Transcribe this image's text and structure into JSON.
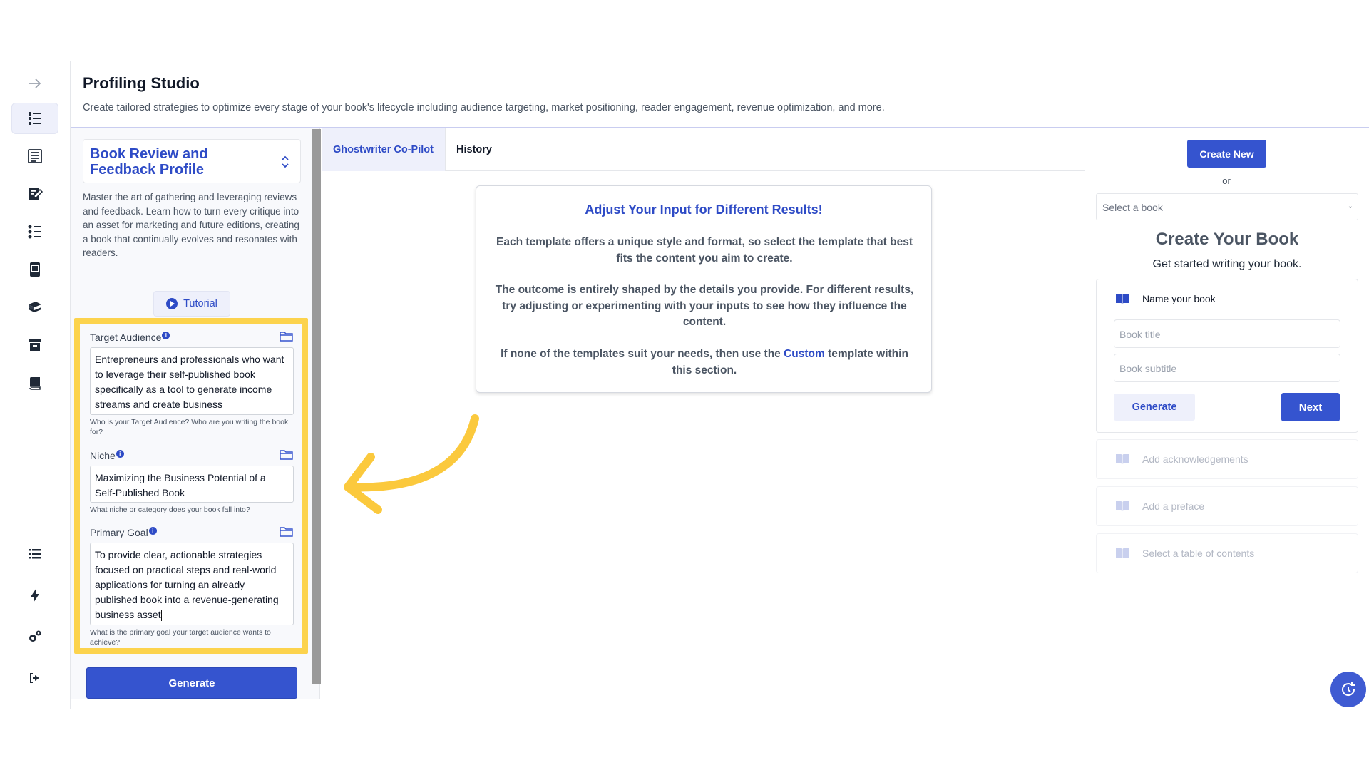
{
  "header": {
    "title": "Profiling Studio",
    "subtitle": "Create tailored strategies to optimize every stage of your book's lifecycle including audience targeting, market positioning, reader engagement, revenue optimization, and more."
  },
  "rail": {
    "icons": [
      "arrow-right-icon",
      "numbered-list-icon",
      "document-list-icon",
      "note-pen-icon",
      "checklist-icon",
      "mobile-book-icon",
      "books-stack-icon",
      "archive-icon",
      "book-icon",
      "list-icon",
      "lightning-icon",
      "gears-icon",
      "logout-icon"
    ]
  },
  "profile": {
    "title": "Book Review and Feedback Profile",
    "description": "Master the art of gathering and leveraging reviews and feedback. Learn how to turn every critique into an asset for marketing and future editions, creating a book that continually evolves and resonates with readers.",
    "tutorial_label": "Tutorial"
  },
  "fields": {
    "target_audience": {
      "label": "Target Audience",
      "value": "Entrepreneurs and professionals who want to leverage their self-published book specifically as a tool to generate income streams and create business",
      "hint": "Who is your Target Audience? Who are you writing the book for?"
    },
    "niche": {
      "label": "Niche",
      "value": "Maximizing the Business Potential of a Self-Published Book",
      "hint": "What niche or category does your book fall into?"
    },
    "primary_goal": {
      "label": "Primary Goal",
      "value": "To provide clear, actionable strategies focused on practical steps and real-world applications for turning an already published book into a revenue-generating business asset",
      "hint": "What is the primary goal your target audience wants to achieve?"
    }
  },
  "generate_label": "Generate",
  "tabs": [
    {
      "label": "Ghostwriter Co-Pilot",
      "active": true
    },
    {
      "label": "History",
      "active": false
    }
  ],
  "info_card": {
    "heading": "Adjust Your Input for Different Results!",
    "p1": "Each template offers a unique style and format, so select the template that best fits the content you aim to create.",
    "p2": "The outcome is entirely shaped by the details you provide. For different results, try adjusting or experimenting with your inputs to see how they influence the content.",
    "p3_before": "If none of the templates suit your needs, then use the ",
    "p3_link": "Custom",
    "p3_after": " template within this section."
  },
  "right_panel": {
    "create_new_label": "Create New",
    "or_text": "or",
    "book_select_value": "Select a book",
    "title": "Create Your Book",
    "subtitle": "Get started writing your book.",
    "name_label": "Name your book",
    "book_title_placeholder": "Book title",
    "book_subtitle_placeholder": "Book subtitle",
    "generate_label": "Generate",
    "next_label": "Next",
    "steps": [
      "Add acknowledgements",
      "Add a preface",
      "Select a table of contents"
    ]
  },
  "colors": {
    "accent": "#3554cf",
    "accent_text": "#2e4bc6",
    "highlight": "#fcd34d",
    "arrow": "#fbc93d"
  }
}
